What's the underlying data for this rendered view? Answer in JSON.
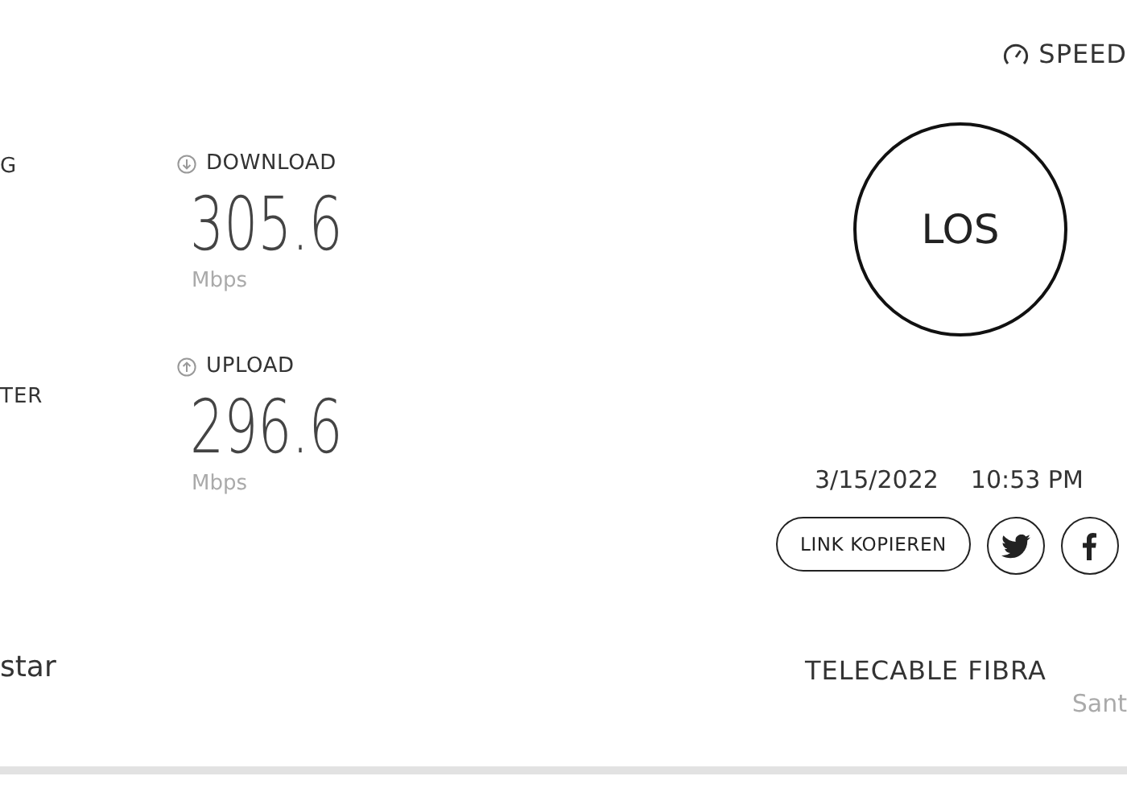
{
  "left_labels": [
    "G",
    "TER"
  ],
  "metrics": [
    {
      "kind": "download",
      "label": "DOWNLOAD",
      "value": "305.6",
      "unit": "Mbps"
    },
    {
      "kind": "upload",
      "label": "UPLOAD",
      "value": "296.6",
      "unit": "Mbps"
    }
  ],
  "left_footer": "star",
  "brand": "SPEED",
  "go_button": "LOS",
  "date": "3/15/2022",
  "time": "10:53 PM",
  "share": {
    "copy_link": "LINK KOPIEREN",
    "networks": [
      {
        "kind": "twitter"
      },
      {
        "kind": "facebook"
      }
    ]
  },
  "provider": {
    "name": "TELECABLE FIBRA",
    "location": "Sant"
  }
}
